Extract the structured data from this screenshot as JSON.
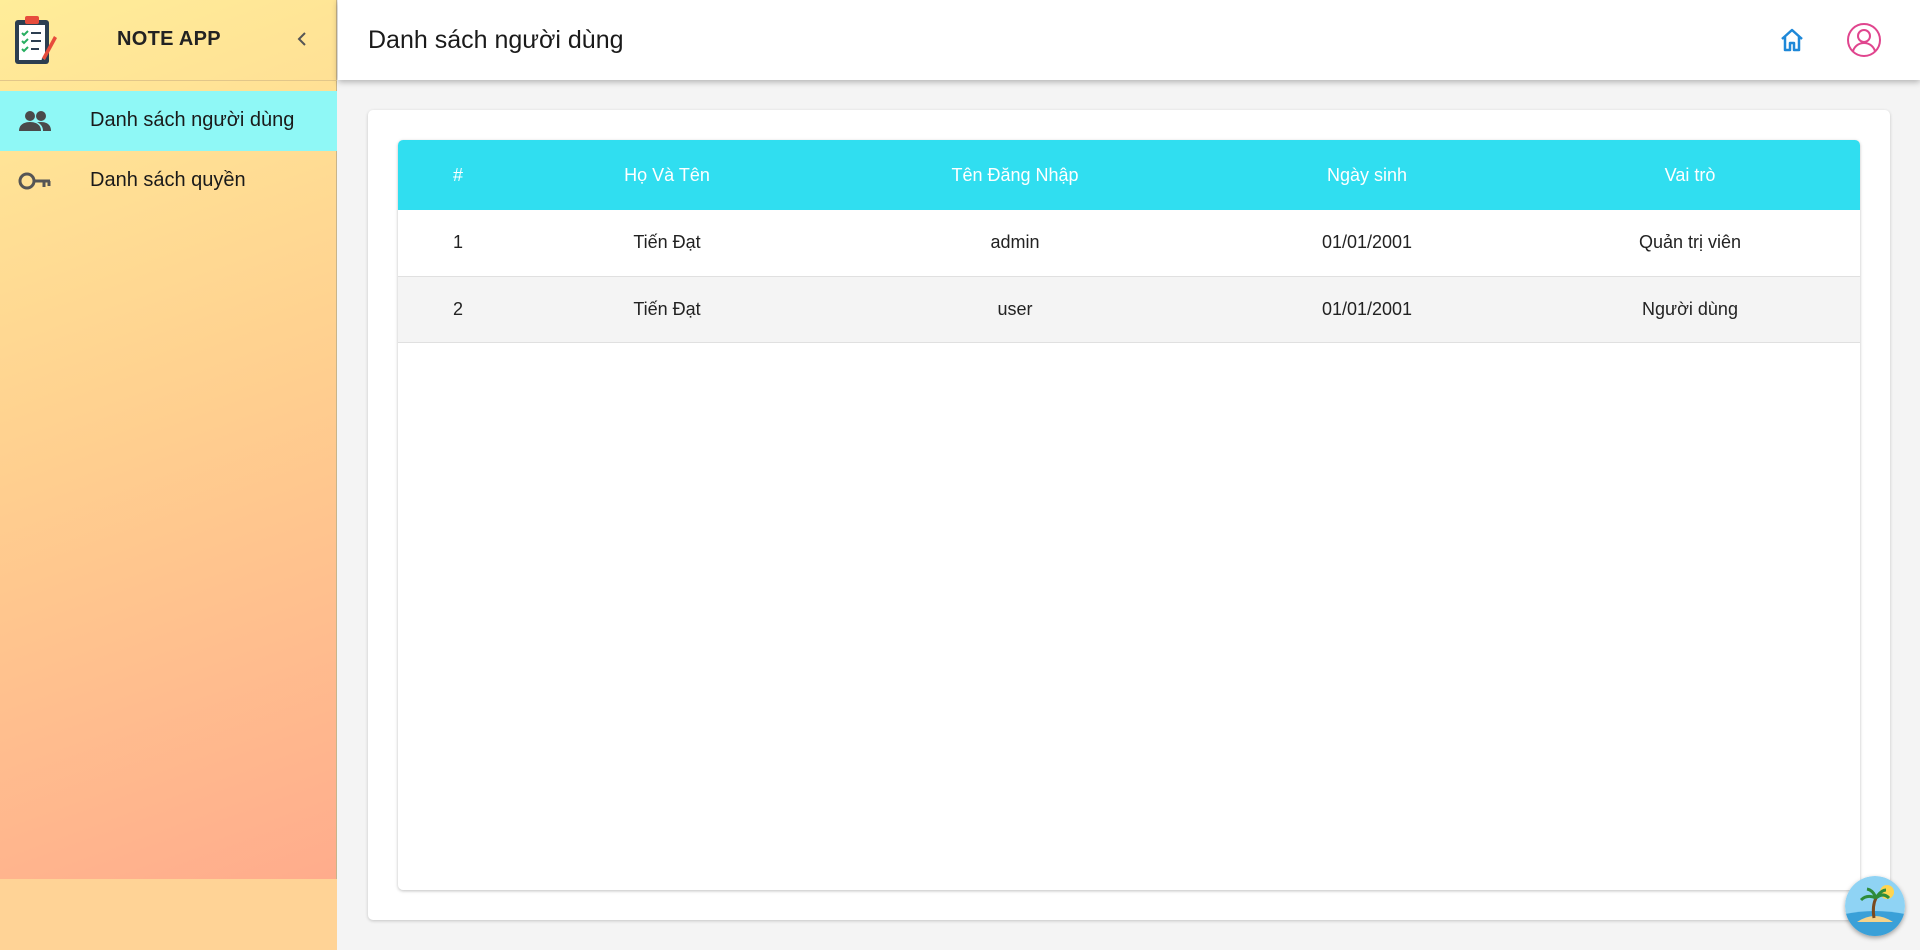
{
  "app": {
    "title": "NOTE APP"
  },
  "sidebar": {
    "items": [
      {
        "label": "Danh sách người dùng",
        "icon": "people-icon",
        "active": true
      },
      {
        "label": "Danh sách quyền",
        "icon": "key-icon",
        "active": false
      }
    ]
  },
  "header": {
    "title": "Danh sách người dùng"
  },
  "table": {
    "columns": [
      "#",
      "Họ Và Tên",
      "Tên Đăng Nhập",
      "Ngày sinh",
      "Vai trò"
    ],
    "rows": [
      [
        "1",
        "Tiến Đạt",
        "admin",
        "01/01/2001",
        "Quản trị viên"
      ],
      [
        "2",
        "Tiến Đạt",
        "user",
        "01/01/2001",
        "Người dùng"
      ]
    ]
  },
  "colors": {
    "header_row": "#30def0",
    "active_nav": "#8ff8f6",
    "home_icon": "#1e88d8",
    "account_icon": "#e0458e"
  }
}
